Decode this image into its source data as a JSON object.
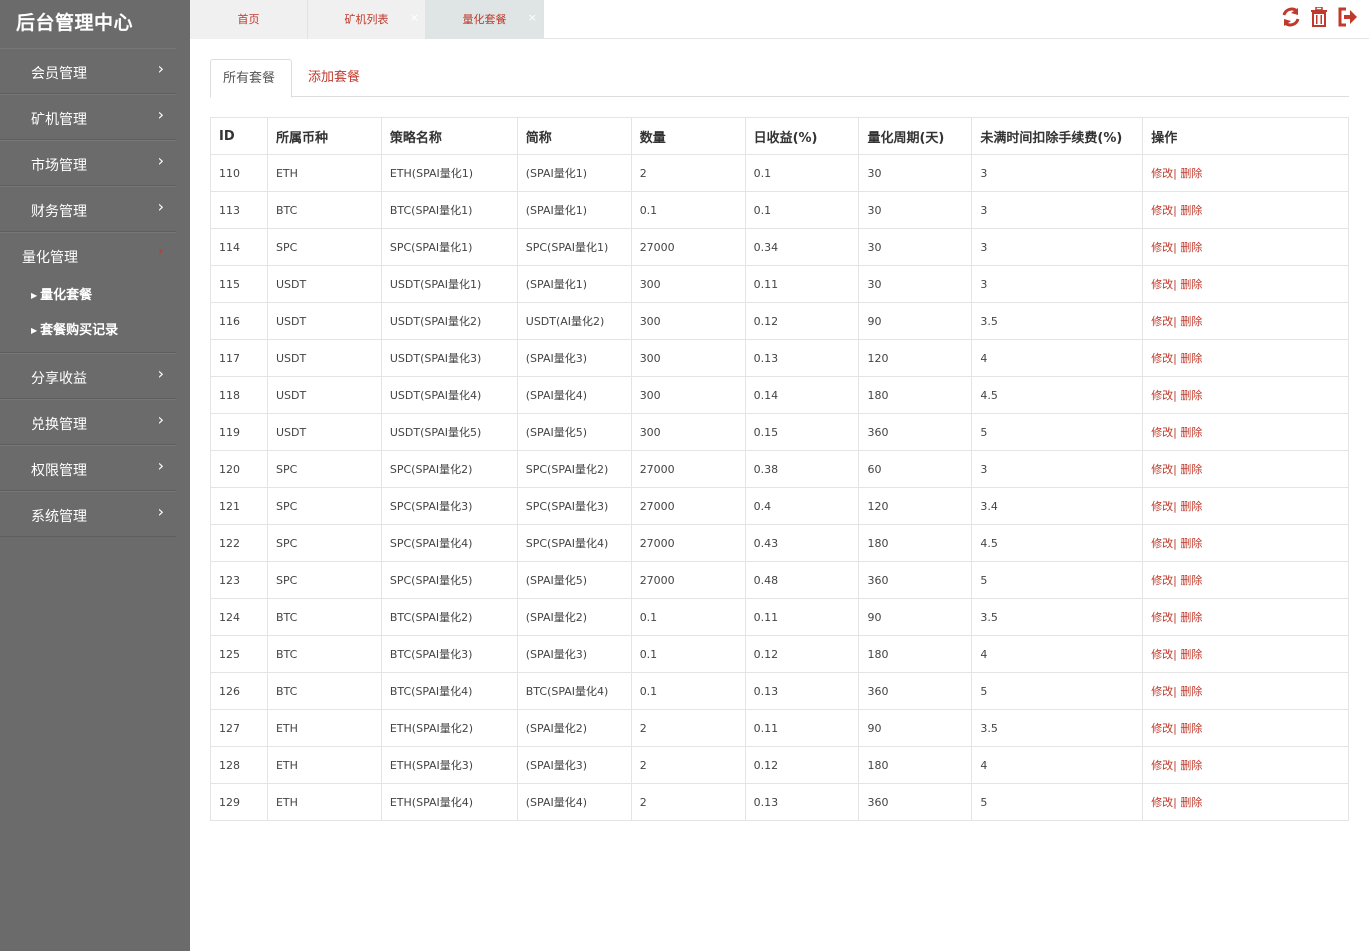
{
  "sidebar": {
    "brand": "后台管理中心",
    "menu_top": [
      {
        "label": "会员管理",
        "chevron": "›"
      },
      {
        "label": "矿机管理",
        "chevron": "›"
      },
      {
        "label": "市场管理",
        "chevron": "›"
      },
      {
        "label": "财务管理",
        "chevron": "›"
      }
    ],
    "open_menu": {
      "label": "量化管理",
      "chevron": "›",
      "subitems": [
        {
          "label": "量化套餐",
          "marker": "▶"
        },
        {
          "label": "套餐购买记录",
          "marker": "▶"
        }
      ]
    },
    "menu_bottom": [
      {
        "label": "分享收益",
        "chevron": "›"
      },
      {
        "label": "兑换管理",
        "chevron": "›"
      },
      {
        "label": "权限管理",
        "chevron": "›"
      },
      {
        "label": "系统管理",
        "chevron": "›"
      }
    ]
  },
  "tabs": [
    {
      "label": "首页"
    },
    {
      "label": "矿机列表",
      "close": "×"
    },
    {
      "label": "量化套餐",
      "close": "×"
    }
  ],
  "toolbar": {
    "refresh_icon": "refresh-icon",
    "trash_icon": "trash-icon",
    "logout_icon": "logout-icon",
    "accent": "#c0392b"
  },
  "content_tabs": {
    "all": "所有套餐",
    "add": "添加套餐"
  },
  "table": {
    "headers": [
      "ID",
      "所属币种",
      "策略名称",
      "简称",
      "数量",
      "日收益(%)",
      "量化周期(天)",
      "未满时间扣除手续费(%)",
      "操作"
    ],
    "edit_label": "修改|",
    "delete_label": " 删除",
    "rows": [
      [
        "110",
        "ETH",
        "ETH(SPAI量化1)",
        "(SPAI量化1)",
        "2",
        "0.1",
        "30",
        "3"
      ],
      [
        "113",
        "BTC",
        "BTC(SPAI量化1)",
        "(SPAI量化1)",
        "0.1",
        "0.1",
        "30",
        "3"
      ],
      [
        "114",
        "SPC",
        "SPC(SPAI量化1)",
        "SPC(SPAI量化1)",
        "27000",
        "0.34",
        "30",
        "3"
      ],
      [
        "115",
        "USDT",
        "USDT(SPAI量化1)",
        "(SPAI量化1)",
        "300",
        "0.11",
        "30",
        "3"
      ],
      [
        "116",
        "USDT",
        "USDT(SPAI量化2)",
        "USDT(AI量化2)",
        "300",
        "0.12",
        "90",
        "3.5"
      ],
      [
        "117",
        "USDT",
        "USDT(SPAI量化3)",
        "(SPAI量化3)",
        "300",
        "0.13",
        "120",
        "4"
      ],
      [
        "118",
        "USDT",
        "USDT(SPAI量化4)",
        "(SPAI量化4)",
        "300",
        "0.14",
        "180",
        "4.5"
      ],
      [
        "119",
        "USDT",
        "USDT(SPAI量化5)",
        "(SPAI量化5)",
        "300",
        "0.15",
        "360",
        "5"
      ],
      [
        "120",
        "SPC",
        "SPC(SPAI量化2)",
        "SPC(SPAI量化2)",
        "27000",
        "0.38",
        "60",
        "3"
      ],
      [
        "121",
        "SPC",
        "SPC(SPAI量化3)",
        "SPC(SPAI量化3)",
        "27000",
        "0.4",
        "120",
        "3.4"
      ],
      [
        "122",
        "SPC",
        "SPC(SPAI量化4)",
        "SPC(SPAI量化4)",
        "27000",
        "0.43",
        "180",
        "4.5"
      ],
      [
        "123",
        "SPC",
        "SPC(SPAI量化5)",
        "(SPAI量化5)",
        "27000",
        "0.48",
        "360",
        "5"
      ],
      [
        "124",
        "BTC",
        "BTC(SPAI量化2)",
        "(SPAI量化2)",
        "0.1",
        "0.11",
        "90",
        "3.5"
      ],
      [
        "125",
        "BTC",
        "BTC(SPAI量化3)",
        "(SPAI量化3)",
        "0.1",
        "0.12",
        "180",
        "4"
      ],
      [
        "126",
        "BTC",
        "BTC(SPAI量化4)",
        "BTC(SPAI量化4)",
        "0.1",
        "0.13",
        "360",
        "5"
      ],
      [
        "127",
        "ETH",
        "ETH(SPAI量化2)",
        "(SPAI量化2)",
        "2",
        "0.11",
        "90",
        "3.5"
      ],
      [
        "128",
        "ETH",
        "ETH(SPAI量化3)",
        "(SPAI量化3)",
        "2",
        "0.12",
        "180",
        "4"
      ],
      [
        "129",
        "ETH",
        "ETH(SPAI量化4)",
        "(SPAI量化4)",
        "2",
        "0.13",
        "360",
        "5"
      ]
    ]
  }
}
